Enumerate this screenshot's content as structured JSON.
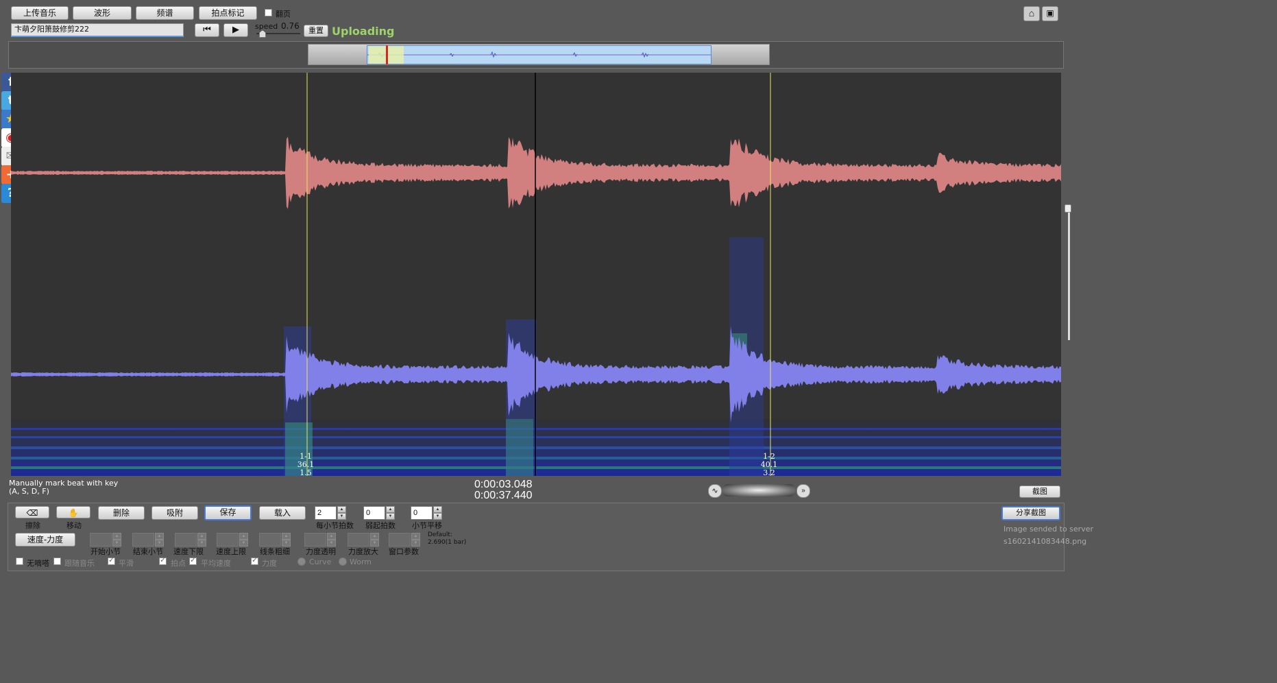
{
  "toolbar": {
    "upload_music": "上传音乐",
    "waveform": "波形",
    "spectrum": "频谱",
    "beat_mark": "拍点标记",
    "flip_page": "翻页",
    "song_title": "卞萌夕阳箫鼓修剪222",
    "speed_label": "speed",
    "speed_value": "0.76",
    "reset": "重置",
    "status": "Uploading"
  },
  "viewer": {
    "markers": [
      {
        "lines": [
          "1-1",
          "36.1",
          "1.5"
        ]
      },
      {
        "lines": [
          "1-2",
          "40.1",
          "3.2"
        ]
      }
    ],
    "hint_line1": "Manually mark beat with key",
    "hint_line2": "(A, S, D, F)",
    "time_current": "0:00:03.048",
    "time_total": "0:00:37.440",
    "screenshot": "截图"
  },
  "controls": {
    "erase": "擦除",
    "move": "移动",
    "delete": "删除",
    "snap": "吸附",
    "save": "保存",
    "load": "载入",
    "beats_per_bar_value": "2",
    "beats_per_bar": "每小节拍数",
    "pickup_value": "0",
    "pickup": "弱起拍数",
    "bar_shift_value": "0",
    "bar_shift": "小节平移",
    "speed_force": "速度-力度",
    "start_bar": "开始小节",
    "end_bar": "结束小节",
    "speed_low": "速度下限",
    "speed_high": "速度上限",
    "line_width": "线条粗细",
    "force_alpha": "力度透明",
    "force_zoom": "力度放大",
    "window_param": "窗口参数",
    "default_line1": "Default:",
    "default_line2": "2.690(1 bar)",
    "share_screenshot": "分享截图",
    "image_status": "Image sended to server",
    "image_id": "s1602141083448.png",
    "opt_silence": "无嘀嗒",
    "opt_follow": "跟随音乐",
    "opt_smooth": "平滑",
    "opt_beat": "拍点",
    "opt_avg_speed": "平均速度",
    "opt_force": "力度",
    "opt_curve": "Curve",
    "opt_worm": "Worm"
  },
  "icons": [
    "facebook-icon",
    "twitter-icon",
    "star-icon",
    "weibo-icon",
    "mail-icon",
    "plus-icon",
    "help-icon",
    "home-icon",
    "fullscreen-icon",
    "waveform-icon",
    "fast-forward-icon"
  ],
  "colors": {
    "channel_top": "#d27f7f",
    "channel_bottom": "#7f7fe0",
    "marker_line": "#e8e85a",
    "playhead": "#000000",
    "status": "#9ed36a"
  }
}
